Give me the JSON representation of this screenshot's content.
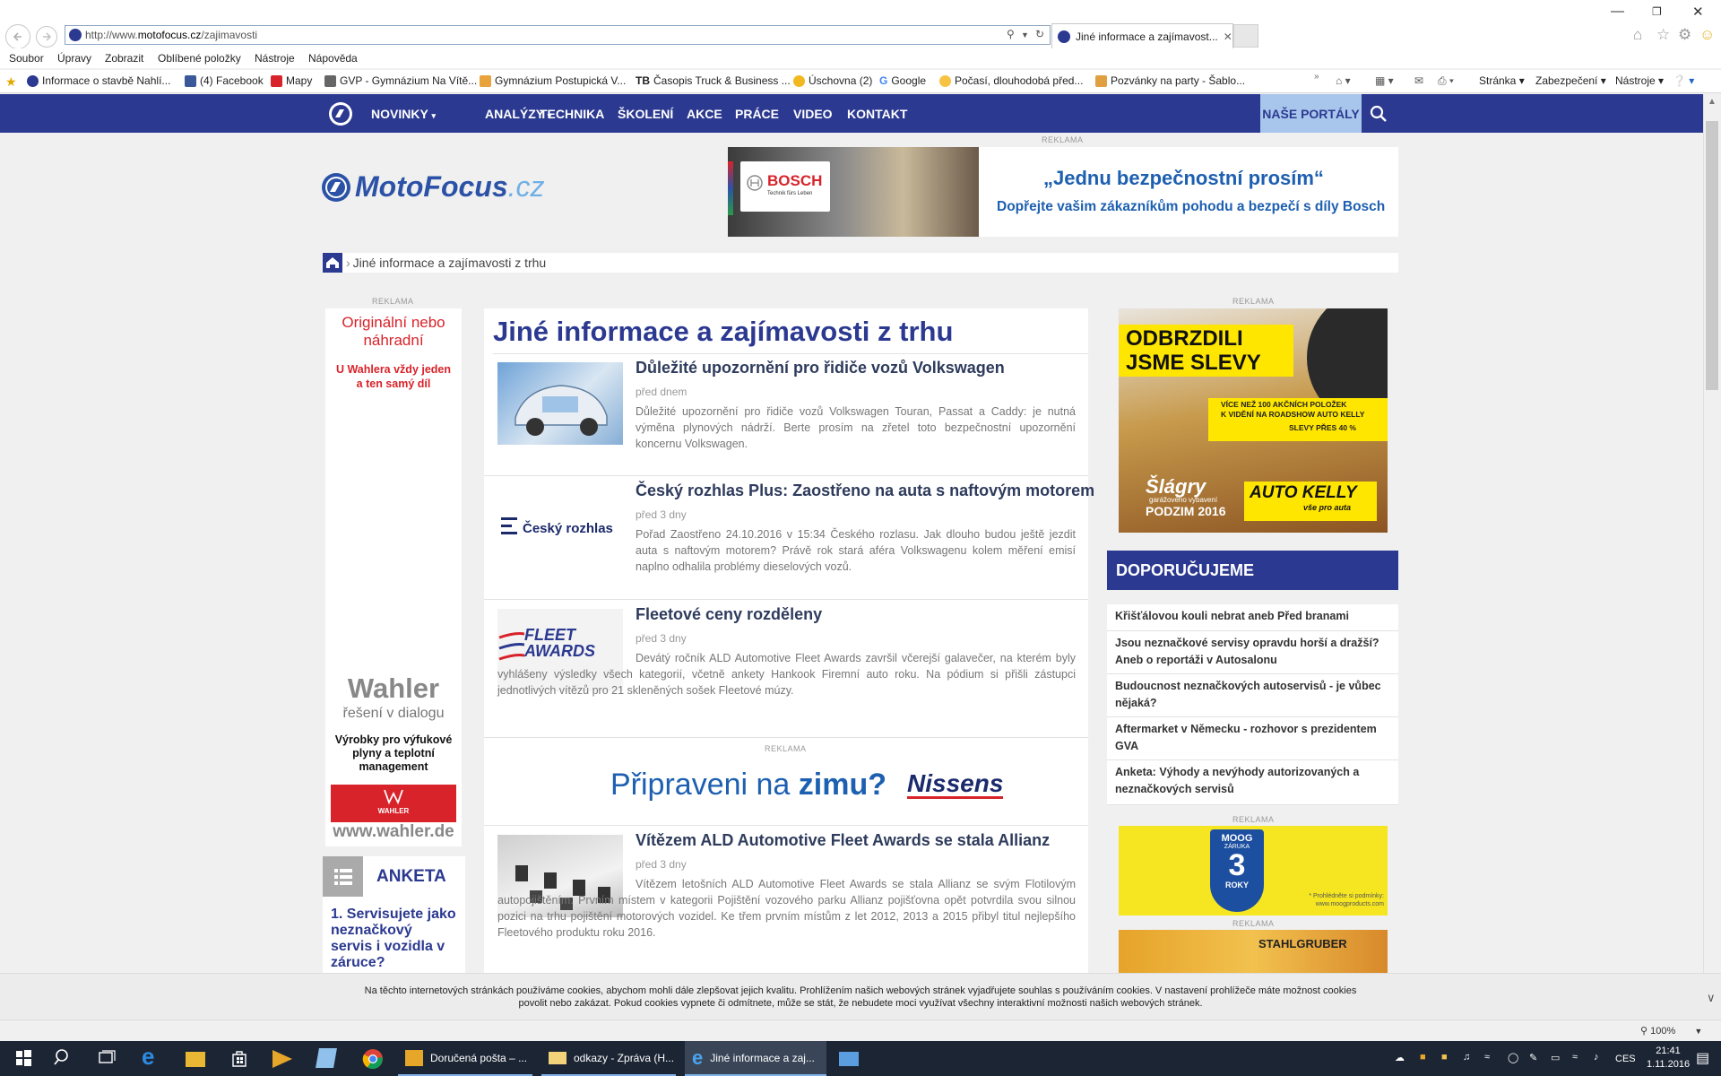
{
  "browser": {
    "url_prefix": "http://www.",
    "url_domain": "motofocus.cz",
    "url_path": "/zajimavosti",
    "tab_title": "Jiné informace a zajímavost...",
    "menu": [
      "Soubor",
      "Úpravy",
      "Zobrazit",
      "Oblíbené položky",
      "Nástroje",
      "Nápověda"
    ],
    "favorites": [
      {
        "label": "Informace o stavbě  Nahlí...",
        "color": "#2b3990"
      },
      {
        "label": "(4) Facebook",
        "color": "#3b5998"
      },
      {
        "label": "Mapy",
        "color": "#d8232a"
      },
      {
        "label": "GVP - Gymnázium Na Vítě...",
        "color": "#666666"
      },
      {
        "label": "Gymnázium Postupická  V...",
        "color": "#e8a33d"
      },
      {
        "label": "Časopis Truck & Business ...",
        "color": "#222222"
      },
      {
        "label": "Úschovna (2)",
        "color": "#f2b81f"
      },
      {
        "label": "Google",
        "color": "#4285f4"
      },
      {
        "label": "Počasí, dlouhodobá před...",
        "color": "#f6c343"
      },
      {
        "label": "Pozvánky na party - Šablo...",
        "color": "#e0a040"
      }
    ],
    "commands": [
      "Stránka",
      "Zabezpečení",
      "Nástroje"
    ]
  },
  "site_nav": {
    "items": [
      "NOVINKY",
      "ANALÝZY",
      "TECHNIKA",
      "ŠKOLENÍ",
      "AKCE",
      "PRÁCE",
      "VIDEO",
      "KONTAKT"
    ],
    "portals": "NAŠE PORTÁLY"
  },
  "ad_label": "REKLAMA",
  "logo": {
    "part1": "MotoFocus",
    "part2": ".cz"
  },
  "bosch_ad": {
    "brand": "BOSCH",
    "tagline_small": "Technik fürs Leben",
    "headline": "„Jednu bezpečnostní prosím“",
    "subline": "Dopřejte vašim zákazníkům pohodu a bezpečí s díly Bosch"
  },
  "breadcrumb": "Jiné informace a zajímavosti z trhu",
  "wahler_ad": {
    "line1": "Originální nebo náhradní",
    "line2": "U Wahlera vždy jeden a ten samý díl",
    "brand": "Wahler",
    "slogan": "řešení v dialogu",
    "products": "Výrobky pro výfukové plyny a teplotní management",
    "badge": "WAHLER",
    "url": "www.wahler.de"
  },
  "poll": {
    "heading": "ANKETA",
    "question": "1. Servisujete jako neznačkový servis i vozidla v záruce?"
  },
  "page_title": "Jiné informace a zajímavosti z trhu",
  "articles": [
    {
      "title": "Důležité upozornění pro řidiče vozů Volkswagen",
      "date": "před dnem",
      "text": "Důležité upozornění pro řidiče vozů Volkswagen Touran, Passat a Caddy: je nutná výměna plynových nádrží. Berte prosím na zřetel toto bezpečnostní upozornění koncernu Volkswagen."
    },
    {
      "title": "Český rozhlas Plus: Zaostřeno na auta s naftovým motorem",
      "date": "před 3 dny",
      "thumb": "Český rozhlas",
      "text": "Pořad Zaostřeno 24.10.2016 v 15:34 Českého rozlasu. Jak dlouho budou ještě jezdit auta s naftovým motorem? Právě rok stará aféra Volkswagenu kolem měření emisí naplno odhalila problémy dieselových vozů."
    },
    {
      "title": "Fleetové ceny rozděleny",
      "date": "před 3 dny",
      "thumb": "FLEET AWARDS",
      "text": "Devátý ročník ALD Automotive Fleet Awards završil včerejší galavečer, na kterém byly vyhlášeny výsledky všech kategorií, včetně ankety Hankook Firemní auto roku. Na pódium si přišli zástupci jednotlivých vítězů pro 21 skleněných sošek Fleetové múzy."
    },
    {
      "title": "Vítězem ALD Automotive Fleet Awards se stala Allianz",
      "date": "před 3 dny",
      "text": "Vítězem letošních ALD Automotive Fleet Awards se stala Allianz se svým Flotilovým autopojištěním. Prvním místem v kategorii Pojištění vozového parku Allianz pojišťovna opět potvrdila svou silnou pozici na trhu pojištění motorových vozidel. Ke třem prvním místům z let 2012, 2013 a 2015 přibyl titul nejlepšího Fleetového produktu roku 2016."
    }
  ],
  "nissens_ad": {
    "text_a": "Připraveni na ",
    "text_b": "zimu?",
    "brand": "Nissens"
  },
  "autokelly_ad": {
    "headline": "ODBRZDILI JSME SLEVY",
    "detail1": "VÍCE NEŽ 100 AKČNÍCH POLOŽEK",
    "detail2": "K VIDĚNÍ NA ROADSHOW AUTO KELLY",
    "detail3": "SLEVY PŘES 40 %",
    "slagry": "Šlágry",
    "slagry_sub": "garážového vybavení",
    "season": "PODZIM 2016",
    "brand": "AUTO KELLY",
    "brand_sub": "vše pro auta"
  },
  "recommend": {
    "heading": "DOPORUČUJEME",
    "items": [
      "Křišťálovou kouli nebrat aneb Před branami",
      "Jsou neznačkové servisy opravdu horší a dražší? Aneb o reportáži v Autosalonu",
      "Budoucnost neznačkových autoservisů - je vůbec nějaká?",
      "Aftermarket v Německu - rozhovor s prezidentem GVA",
      "Anketa: Výhody a nevýhody autorizovaných a neznačkových servisů"
    ]
  },
  "moog_ad": {
    "brand": "MOOG",
    "sub": "ZÁRUKA",
    "years": "3",
    "unit": "ROKY",
    "note": "* Prohlédněte si podmínky: www.moogproducts.com"
  },
  "stahlgruber_ad": {
    "brand": "STAHLGRUBER"
  },
  "cookie_notice": {
    "line1": "Na těchto internetových stránkách používáme cookies, abychom mohli dále zlepšovat jejich kvalitu. Prohlížením našich webových stránek vyjadřujete souhlas s používáním cookies. V nastavení prohlížeče máte možnost cookies",
    "line2": "povolit nebo zakázat. Pokud cookies vypnete či odmítnete, může se stát, že nebudete moci využívat všechny interaktivní možnosti našich webových stránek."
  },
  "zoom": "100%",
  "taskbar": {
    "apps": [
      "Doručená pošta – ...",
      "odkazy - Zpráva (H...",
      "Jiné informace a zaj..."
    ],
    "lang": "CES",
    "time": "21:41",
    "date": "1.11.2016"
  },
  "colors": {
    "nav_blue": "#2b3990",
    "portal_bg": "#a8c6ec",
    "autokelly_yellow": "#ffe600",
    "wahler_red": "#d8232a"
  }
}
